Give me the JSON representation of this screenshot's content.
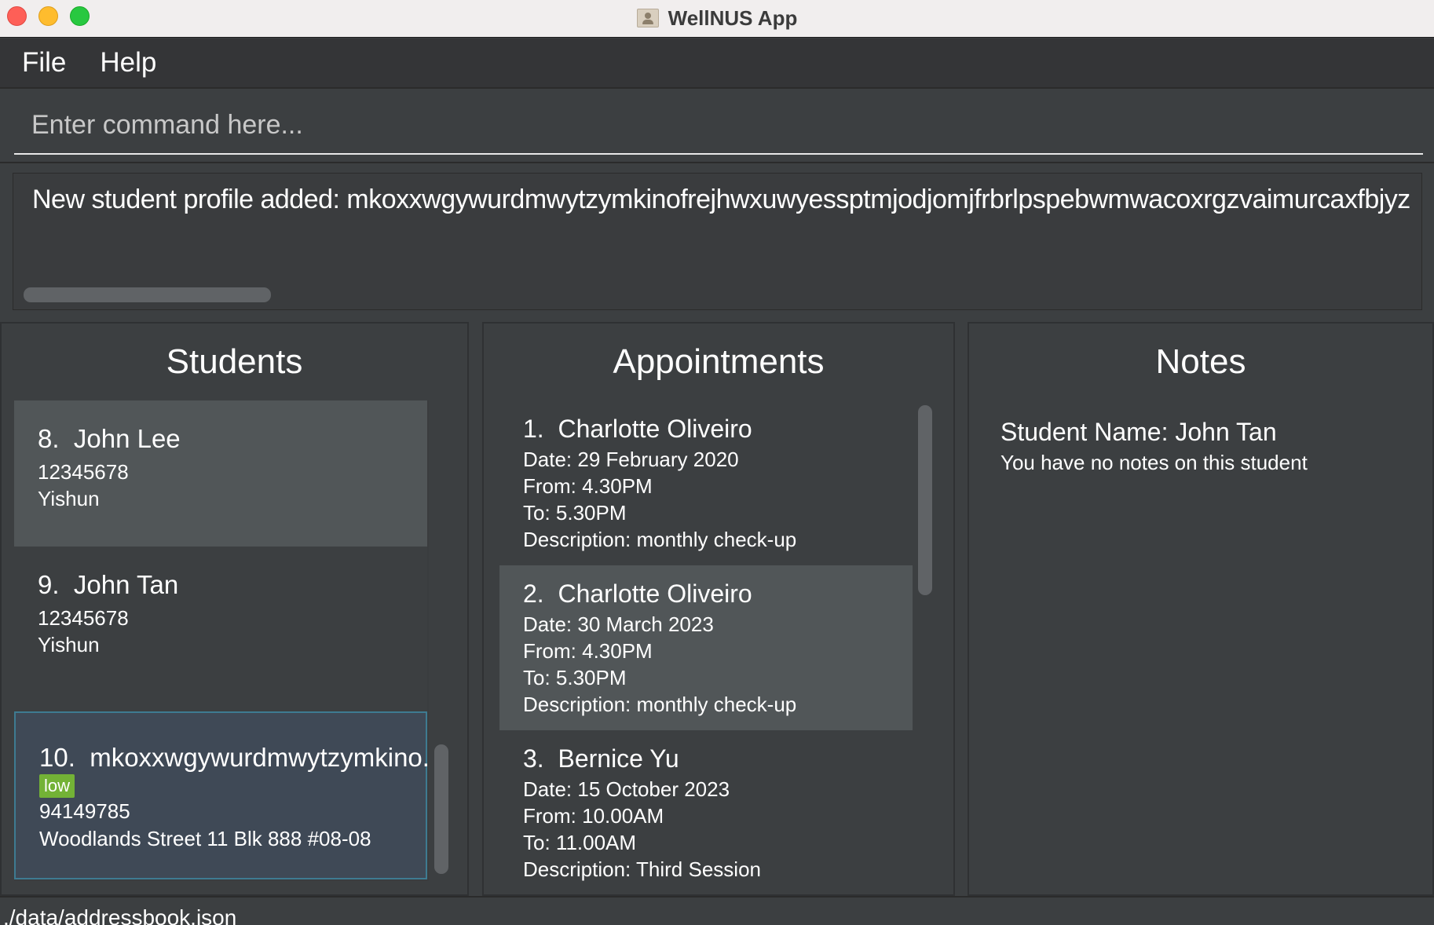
{
  "window": {
    "title": "WellNUS App"
  },
  "menu": {
    "items": [
      "File",
      "Help"
    ]
  },
  "command": {
    "placeholder": "Enter command here...",
    "value": ""
  },
  "result": {
    "text": "New student profile added: mkoxxwgywurdmwytzymkinofrejhwxuwyessptmjodjomjfrbrlpspebwmwacoxrgzvaimurcaxfbjyz"
  },
  "students": {
    "title": "Students",
    "items": [
      {
        "index": "8.",
        "name": "John Lee",
        "phone": "12345678",
        "address": "Yishun"
      },
      {
        "index": "9.",
        "name": "John Tan",
        "phone": "12345678",
        "address": "Yishun"
      },
      {
        "index": "10.",
        "name": "mkoxxwgywurdmwytzymkino...",
        "tag": "low",
        "phone": "94149785",
        "address": "Woodlands Street 11 Blk 888 #08-08"
      }
    ]
  },
  "appointments": {
    "title": "Appointments",
    "items": [
      {
        "index": "1.",
        "name": "Charlotte Oliveiro",
        "date": "Date: 29 February 2020",
        "from": "From: 4.30PM",
        "to": "To: 5.30PM",
        "description": "Description: monthly check-up"
      },
      {
        "index": "2.",
        "name": "Charlotte Oliveiro",
        "date": "Date: 30 March 2023",
        "from": "From: 4.30PM",
        "to": "To: 5.30PM",
        "description": "Description: monthly check-up"
      },
      {
        "index": "3.",
        "name": "Bernice Yu",
        "date": "Date: 15 October 2023",
        "from": "From: 10.00AM",
        "to": "To: 11.00AM",
        "description": "Description: Third Session"
      }
    ]
  },
  "notes": {
    "title": "Notes",
    "student_name": "Student Name: John Tan",
    "body": "You have no notes on this student"
  },
  "status": {
    "path": "./data/addressbook.json"
  },
  "colors": {
    "background": "#3c3f41",
    "selected_card": "#515658",
    "highlight_border": "#3e7b91",
    "tag_low": "#73b236"
  }
}
